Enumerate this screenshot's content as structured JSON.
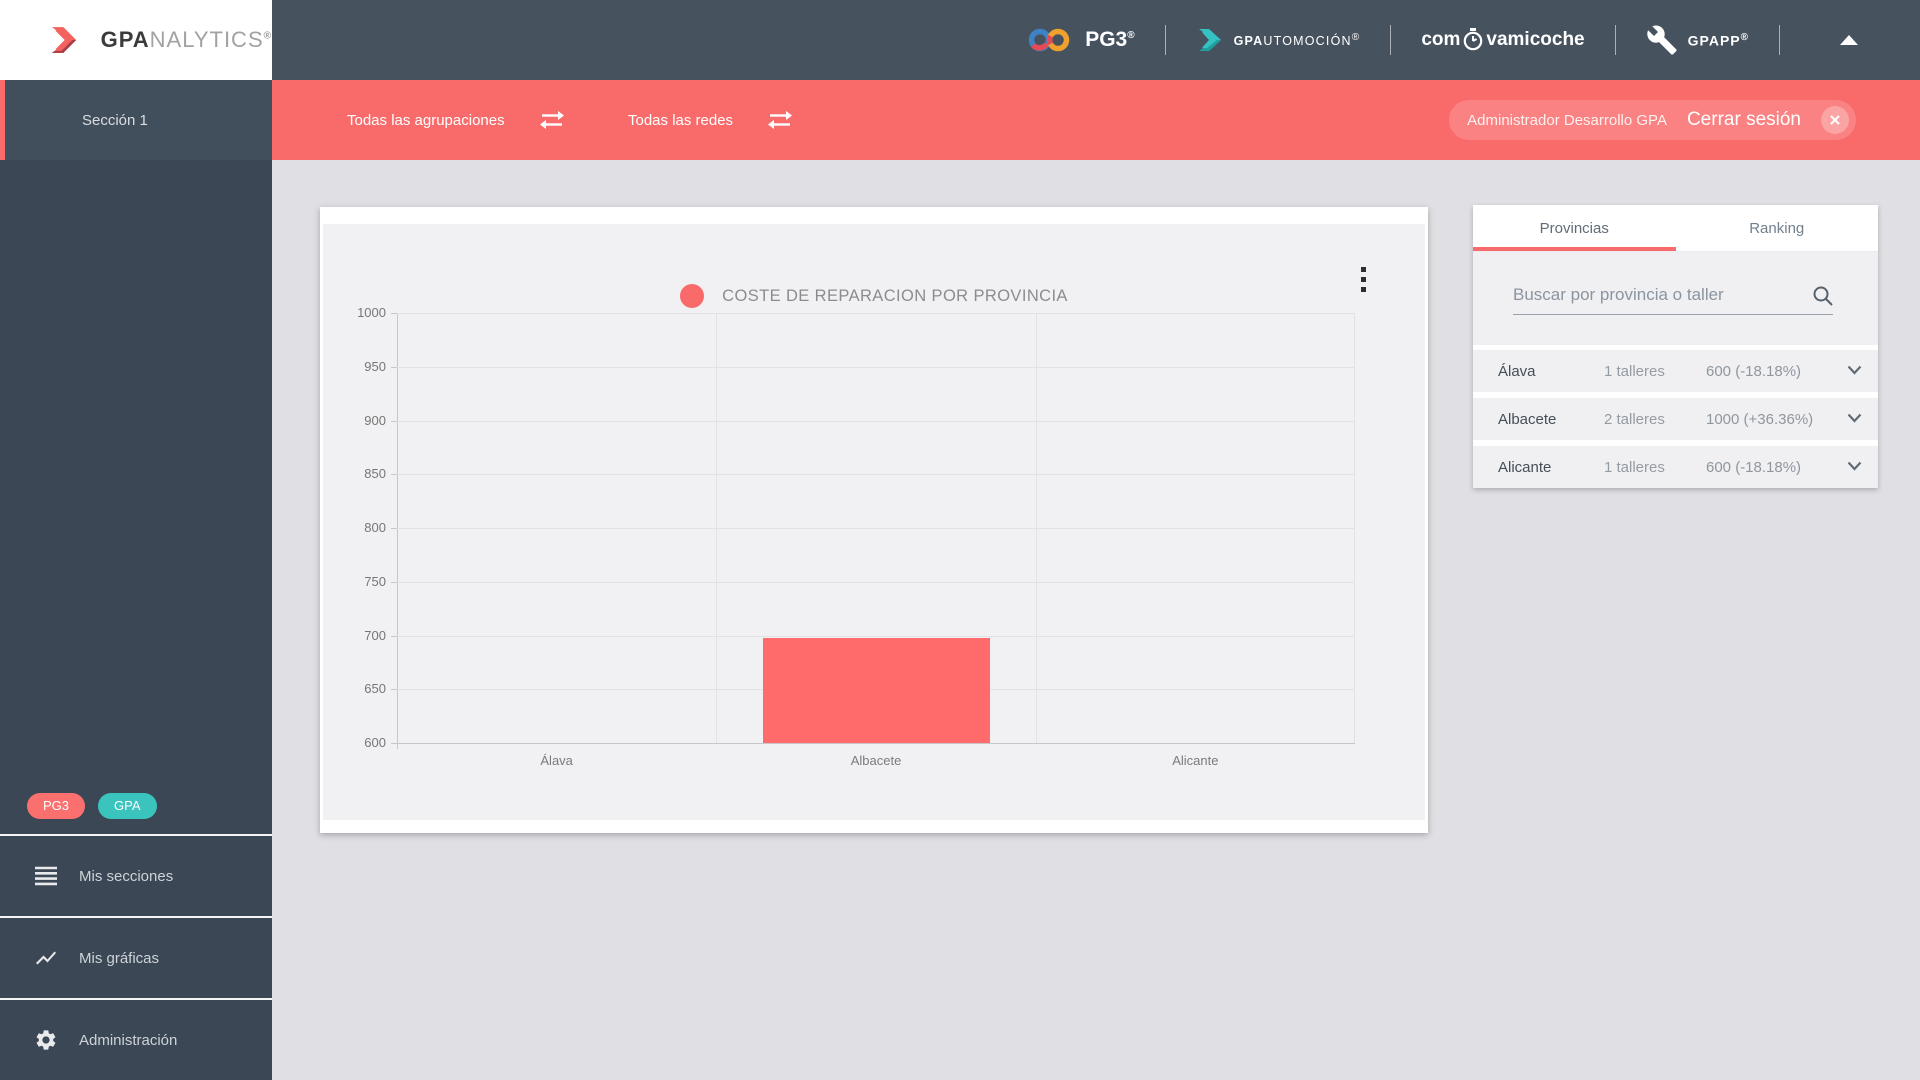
{
  "header": {
    "brand": {
      "bold": "GPA",
      "light": "NALYTICS",
      "reg": "®"
    },
    "partner_logos": {
      "pg3_label": "PG3",
      "pg3_reg": "®",
      "automocion_bold": "GPA",
      "automocion_light": "UTOMOCIÓN",
      "automocion_reg": "®",
      "comeva_prefix": "com",
      "comeva_suffix": "vamicoche",
      "gpapp_label": "GPAPP",
      "gpapp_reg": "®"
    }
  },
  "toolbar": {
    "agrupaciones_label": "Todas las agrupaciones",
    "redes_label": "Todas las redes",
    "user_name": "Administrador Desarrollo GPA",
    "logout_label": "Cerrar sesión",
    "accent_color": "#F96B6B"
  },
  "sidebar": {
    "active_section": "Sección 1",
    "badges": [
      {
        "label": "PG3",
        "color": "#F9706E"
      },
      {
        "label": "GPA",
        "color": "#3BC4BE"
      }
    ],
    "items": [
      {
        "label": "Mis secciones",
        "icon": "list-icon"
      },
      {
        "label": "Mis gráficas",
        "icon": "chart-line-icon"
      },
      {
        "label": "Administración",
        "icon": "gear-icon"
      }
    ]
  },
  "chart_data": {
    "type": "bar",
    "title": "COSTE DE REPARACION POR PROVINCIA",
    "categories": [
      "Álava",
      "Albacete",
      "Alicante"
    ],
    "values": [
      600,
      1000,
      600
    ],
    "displayed_bar_tops": [
      600,
      698,
      600
    ],
    "ylim": [
      600,
      1000
    ],
    "ytick_step": 50,
    "yticks": [
      "1000",
      "950",
      "900",
      "850",
      "800",
      "750",
      "700",
      "650",
      "600"
    ],
    "bar_color": "#FF6B6B",
    "grid": true,
    "legend_dot_color": "#F96B6B",
    "plot_background": "#F1F1F3"
  },
  "panel": {
    "tabs": [
      {
        "label": "Provincias",
        "active": true
      },
      {
        "label": "Ranking",
        "active": false
      }
    ],
    "search_placeholder": "Buscar por provincia o taller",
    "rows": [
      {
        "province": "Álava",
        "talleres": "1 talleres",
        "value": "600 (-18.18%)"
      },
      {
        "province": "Albacete",
        "talleres": "2 talleres",
        "value": "1000 (+36.36%)"
      },
      {
        "province": "Alicante",
        "talleres": "1 talleres",
        "value": "600 (-18.18%)"
      }
    ]
  }
}
